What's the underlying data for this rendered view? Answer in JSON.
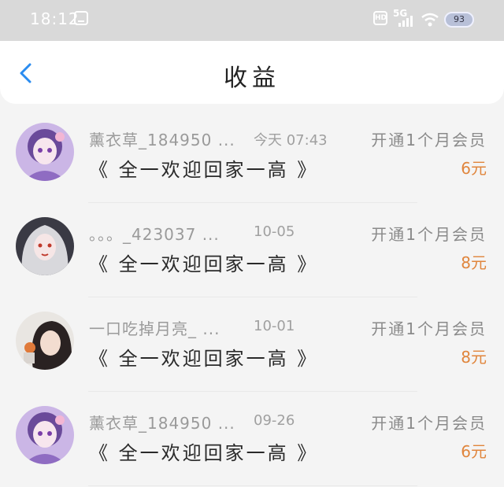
{
  "status_bar": {
    "time": "18:12",
    "network": "5G",
    "hd_label": "HD",
    "battery": "93",
    "icons": [
      "app-icon",
      "hd-icon",
      "signal-icon",
      "wifi-icon",
      "battery-icon"
    ]
  },
  "header": {
    "title": "收益",
    "back_icon": "chevron-left-icon",
    "accent_color": "#2a8cf0"
  },
  "records": [
    {
      "username": "薰衣草_184950 ...",
      "date": "今天 07:43",
      "action": "开通1个月会员",
      "book": "《 全一欢迎回家一高 》",
      "amount": "6元",
      "avatar": "avatar-purple-anime"
    },
    {
      "username": "。。。_423037 ...",
      "date": "10-05",
      "action": "开通1个月会员",
      "book": "《 全一欢迎回家一高 》",
      "amount": "8元",
      "avatar": "avatar-silver-hair"
    },
    {
      "username": "一口吃掉月亮_ ...",
      "date": "10-01",
      "action": "开通1个月会员",
      "book": "《 全一欢迎回家一高 》",
      "amount": "8元",
      "avatar": "avatar-photo-girl"
    },
    {
      "username": "薰衣草_184950 ...",
      "date": "09-26",
      "action": "开通1个月会员",
      "book": "《 全一欢迎回家一高 》",
      "amount": "6元",
      "avatar": "avatar-purple-anime"
    }
  ],
  "amount_color": "#e0853c"
}
